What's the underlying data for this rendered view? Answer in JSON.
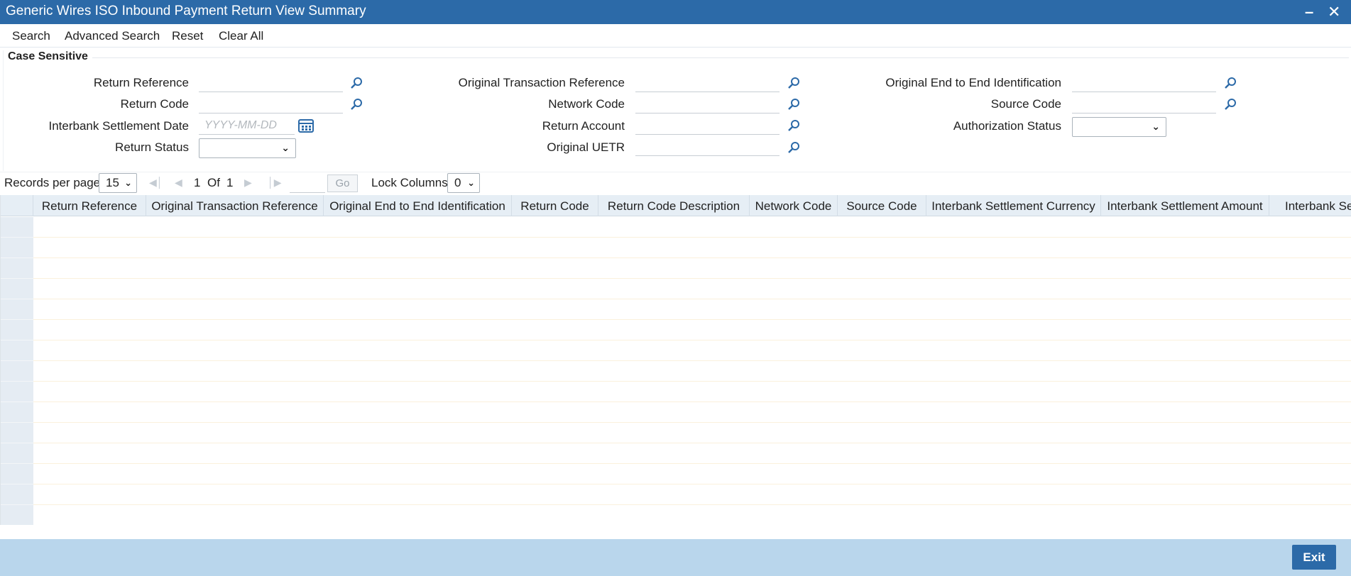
{
  "window": {
    "title": "Generic Wires ISO Inbound Payment Return View Summary",
    "minimize_icon": "minimize-icon",
    "close_icon": "close-icon"
  },
  "toolbar": {
    "search": "Search",
    "advanced_search": "Advanced Search",
    "reset": "Reset",
    "clear_all": "Clear All"
  },
  "criteria": {
    "section_label": "Case Sensitive",
    "return_reference": "Return Reference",
    "return_code": "Return Code",
    "interbank_settlement_date": "Interbank Settlement Date",
    "date_placeholder": "YYYY-MM-DD",
    "return_status": "Return Status",
    "original_transaction_reference": "Original Transaction Reference",
    "network_code": "Network Code",
    "return_account": "Return Account",
    "original_uetr": "Original UETR",
    "original_end_to_end_identification": "Original End to End Identification",
    "source_code": "Source Code",
    "authorization_status": "Authorization Status"
  },
  "pager": {
    "records_per_page_label": "Records per page",
    "records_per_page_value": "15",
    "current_page": "1",
    "of_label": "Of",
    "total_pages": "1",
    "go_label": "Go",
    "lock_columns_label": "Lock Columns",
    "lock_columns_value": "0"
  },
  "grid": {
    "columns": [
      "Return Reference",
      "Original Transaction Reference",
      "Original End to End Identification",
      "Return Code",
      "Return Code Description",
      "Network Code",
      "Source Code",
      "Interbank Settlement Currency",
      "Interbank Settlement Amount",
      "Interbank Se"
    ],
    "row_count": 15
  },
  "footer": {
    "exit_label": "Exit"
  },
  "colors": {
    "titlebar": "#2c6aa8",
    "footer": "#b9d6ec",
    "grid_header": "#e6eef5"
  }
}
